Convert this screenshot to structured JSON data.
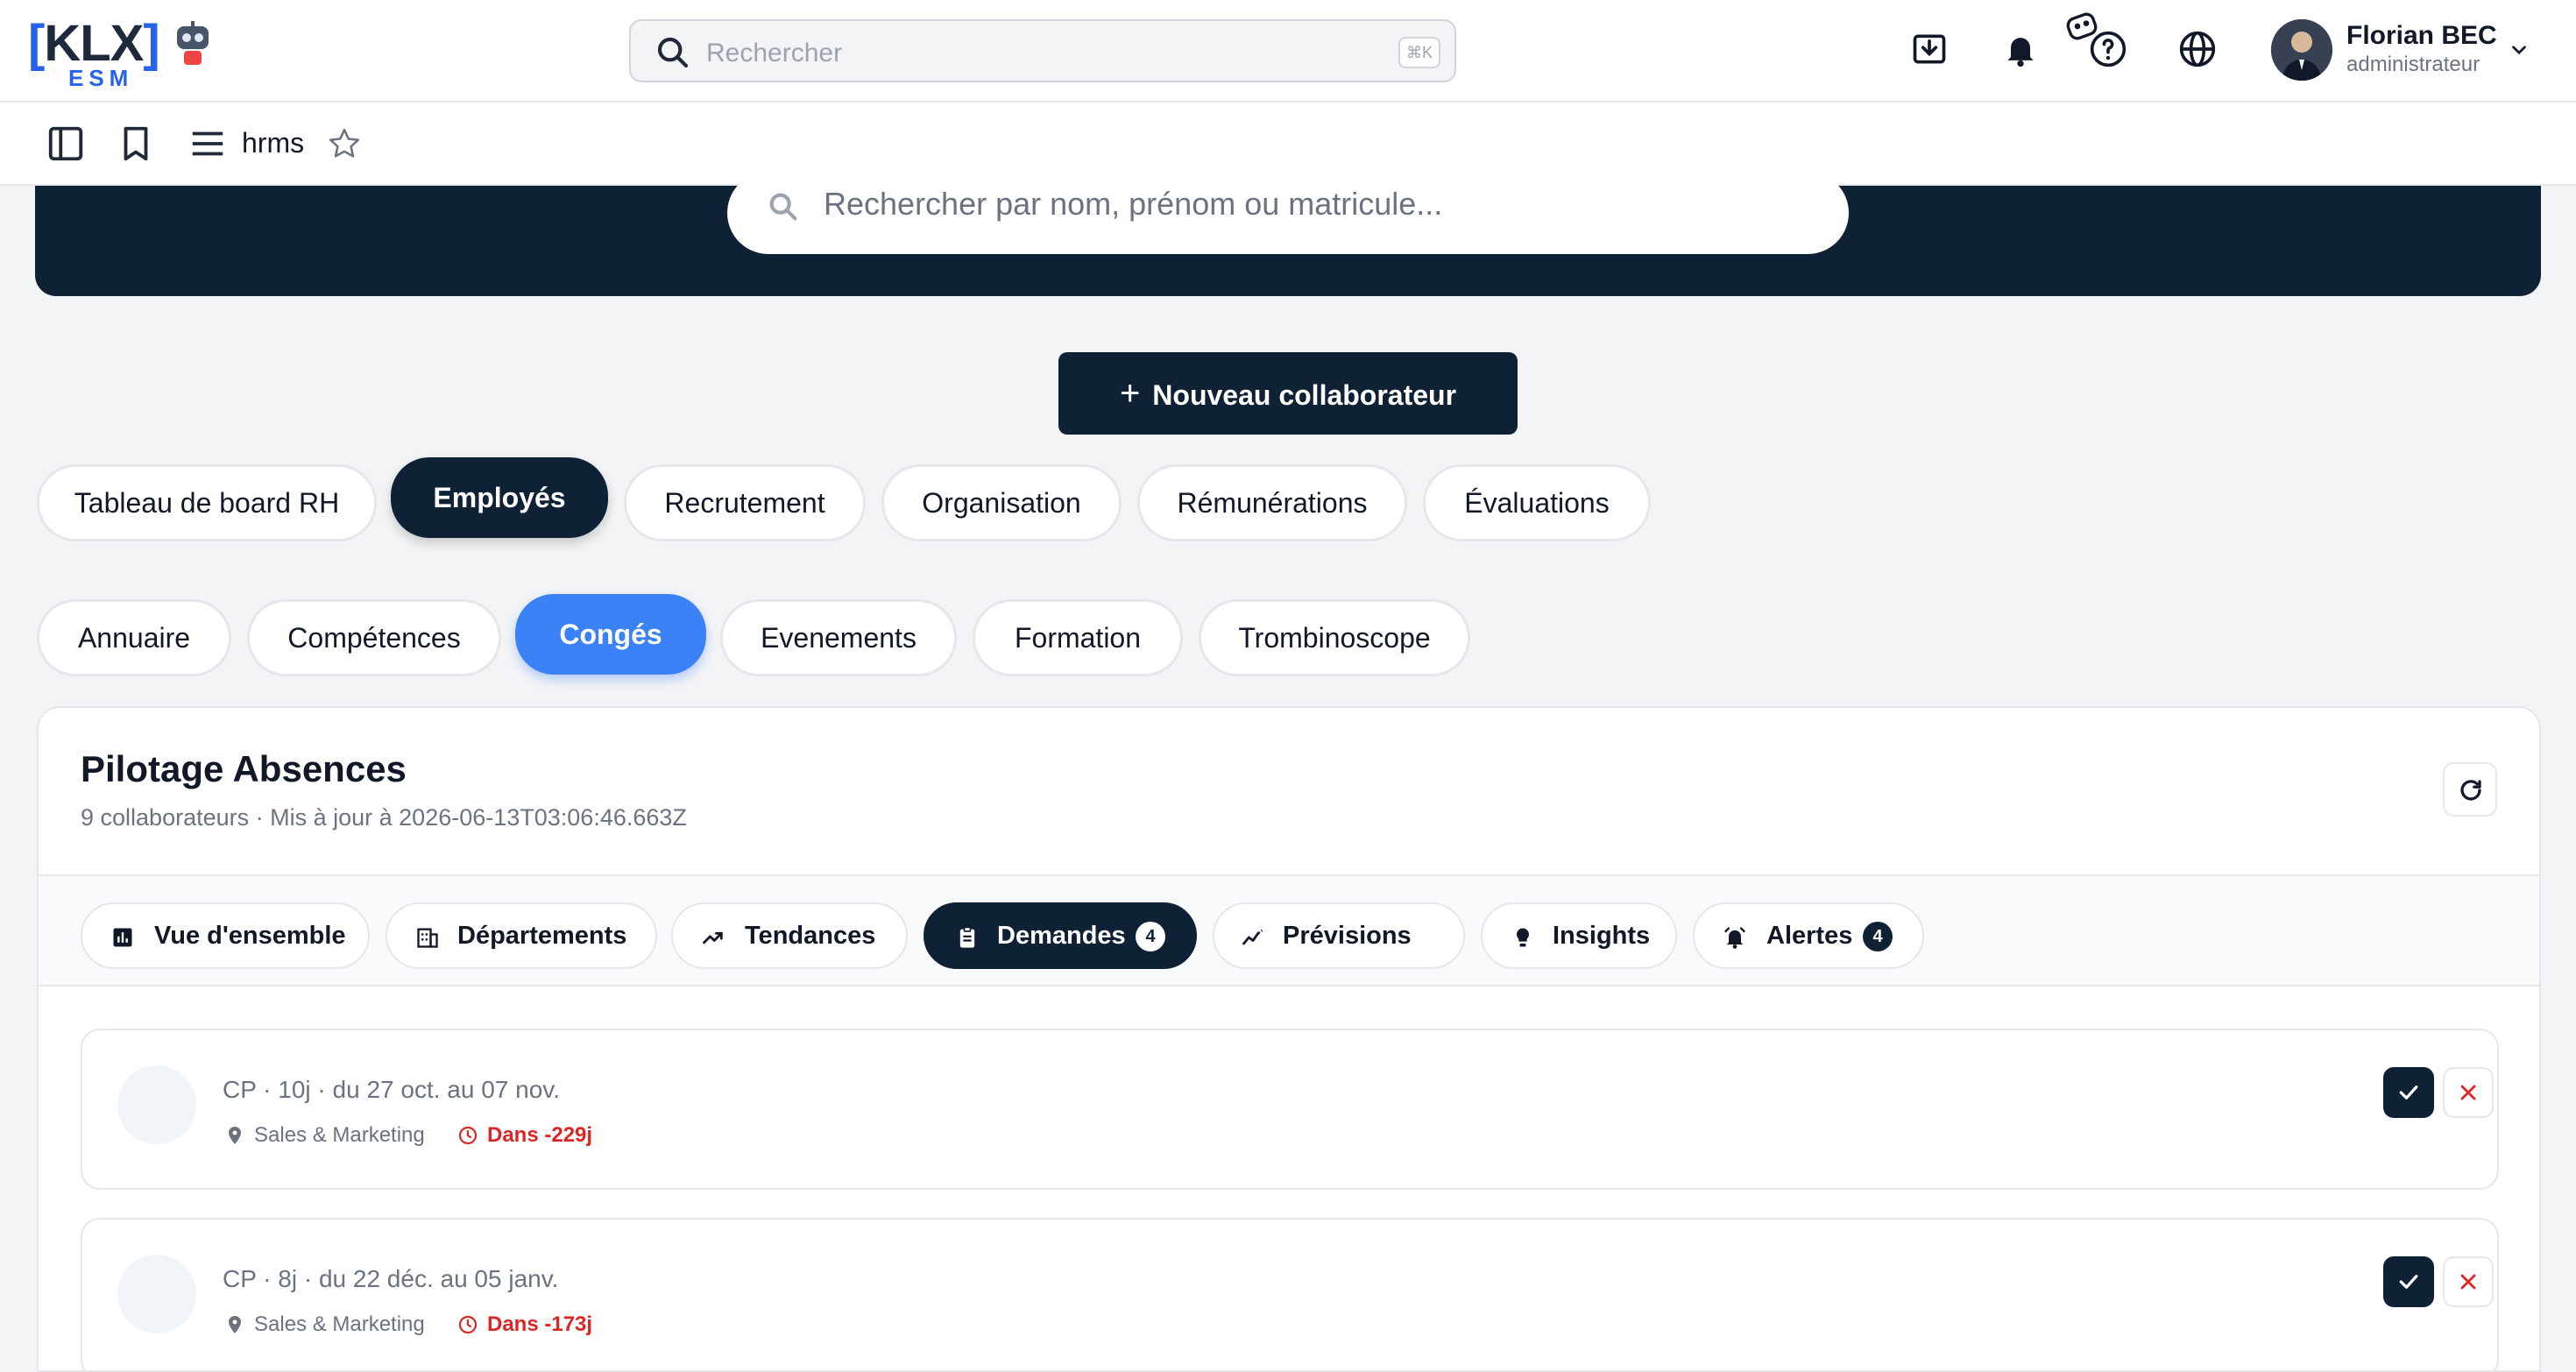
{
  "app": {
    "logo_text": "KLX",
    "logo_sub": "ESM",
    "search_placeholder": "Rechercher",
    "search_shortcut": "⌘K"
  },
  "user": {
    "name": "Florian BEC",
    "role": "administrateur"
  },
  "toolbar": {
    "breadcrumb": "hrms"
  },
  "hero": {
    "search_placeholder": "Rechercher par nom, prénom ou matricule..."
  },
  "actions": {
    "new_employee": "Nouveau collaborateur"
  },
  "main_tabs": [
    {
      "label": "Tableau de board RH"
    },
    {
      "label": "Employés"
    },
    {
      "label": "Recrutement"
    },
    {
      "label": "Organisation"
    },
    {
      "label": "Rémunérations"
    },
    {
      "label": "Évaluations"
    }
  ],
  "sub_tabs": [
    {
      "label": "Annuaire"
    },
    {
      "label": "Compétences"
    },
    {
      "label": "Congés"
    },
    {
      "label": "Evenements"
    },
    {
      "label": "Formation"
    },
    {
      "label": "Trombinoscope"
    }
  ],
  "panel": {
    "title": "Pilotage Absences",
    "subtitle": "9 collaborateurs · Mis à jour à 2026-06-13T03:06:46.663Z"
  },
  "panel_tabs": [
    {
      "label": "Vue d'ensemble",
      "icon": "bar-chart-icon"
    },
    {
      "label": "Départements",
      "icon": "building-icon"
    },
    {
      "label": "Tendances",
      "icon": "trending-up-icon"
    },
    {
      "label": "Demandes",
      "icon": "clipboard-icon",
      "badge": "4"
    },
    {
      "label": "Prévisions",
      "icon": "forecast-icon"
    },
    {
      "label": "Insights",
      "icon": "lightbulb-icon"
    },
    {
      "label": "Alertes",
      "icon": "alarm-icon",
      "badge": "4"
    }
  ],
  "requests": [
    {
      "summary": "CP · 10j · du 27 oct. au 07 nov.",
      "department": "Sales & Marketing",
      "due": "Dans -229j"
    },
    {
      "summary": "CP · 8j · du 22 déc. au 05 janv.",
      "department": "Sales & Marketing",
      "due": "Dans -173j"
    }
  ],
  "colors": {
    "navy": "#0f2235",
    "accent_blue": "#3b82f6",
    "danger": "#dc2626"
  }
}
